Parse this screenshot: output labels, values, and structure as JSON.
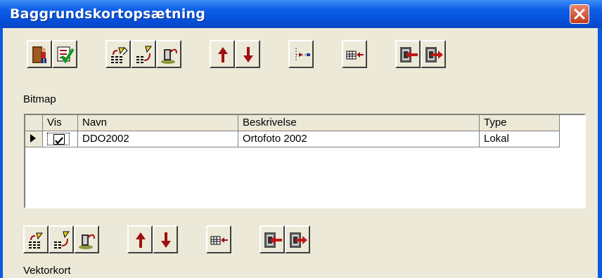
{
  "window": {
    "title": "Baggrundskortopsætning"
  },
  "top_toolbar": {
    "buttons": [
      {
        "name": "exit-door-icon"
      },
      {
        "name": "checklist-ok-icon"
      },
      {
        "name": "edit-grid-icon"
      },
      {
        "name": "edit-grid-2-icon"
      },
      {
        "name": "undo-stack-icon"
      },
      {
        "name": "arrow-up-icon"
      },
      {
        "name": "arrow-down-icon"
      },
      {
        "name": "tree-insert-icon"
      },
      {
        "name": "table-insert-icon"
      },
      {
        "name": "import-icon"
      },
      {
        "name": "export-icon"
      }
    ]
  },
  "bitmap_section": {
    "label": "Bitmap",
    "columns": [
      "Vis",
      "Navn",
      "Beskrivelse",
      "Type"
    ],
    "rows": [
      {
        "vis": true,
        "navn": "DDO2002",
        "beskrivelse": "Ortofoto 2002",
        "type": "Lokal"
      }
    ]
  },
  "bottom_toolbar": {
    "buttons": [
      {
        "name": "edit-grid-icon"
      },
      {
        "name": "edit-grid-2-icon"
      },
      {
        "name": "undo-stack-icon"
      },
      {
        "name": "arrow-up-icon"
      },
      {
        "name": "arrow-down-icon"
      },
      {
        "name": "table-insert-icon"
      },
      {
        "name": "import-icon"
      },
      {
        "name": "export-icon"
      }
    ]
  },
  "vector_section": {
    "label": "Vektorkort"
  },
  "colors": {
    "titlebar": "#0551dc",
    "face": "#ece9d8",
    "arrow": "#a01010"
  }
}
